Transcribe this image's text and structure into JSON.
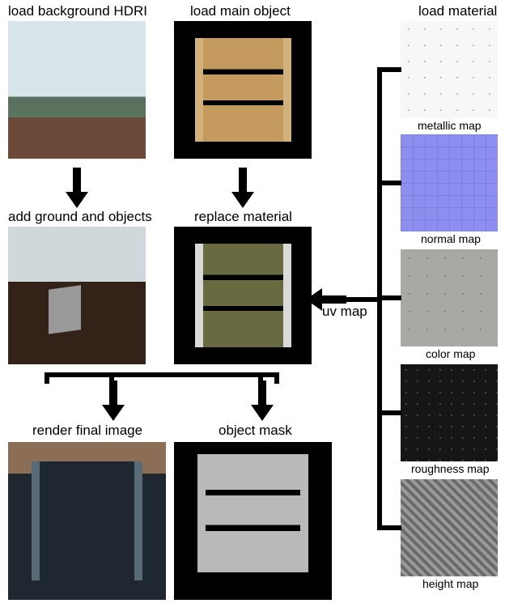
{
  "pipeline": {
    "steps": {
      "load_hdri": "load background HDRI",
      "load_object": "load main object",
      "load_material": "load material",
      "add_ground": "add ground and objects",
      "replace_material": "replace material",
      "render_final": "render final image",
      "object_mask": "object mask",
      "uv_map": "uv map"
    },
    "materials": {
      "metallic": "metallic map",
      "normal": "normal map",
      "color": "color map",
      "roughness": "roughness map",
      "height": "height map"
    }
  }
}
